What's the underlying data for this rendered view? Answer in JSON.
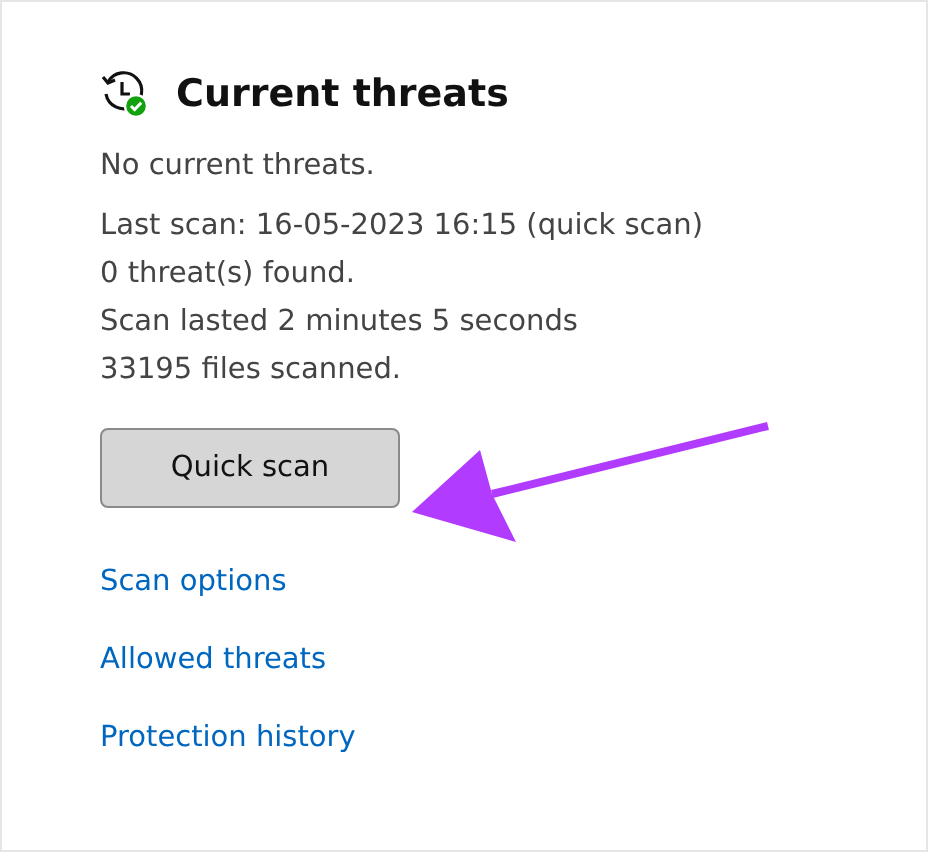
{
  "section": {
    "title": "Current threats"
  },
  "status_lines": [
    "No current threats.",
    "Last scan: 16-05-2023 16:15 (quick scan)",
    "0 threat(s) found.",
    "Scan lasted 2 minutes 5 seconds",
    "33195 files scanned."
  ],
  "button": {
    "label": "Quick scan"
  },
  "links": [
    "Scan options",
    "Allowed threats",
    "Protection history"
  ]
}
